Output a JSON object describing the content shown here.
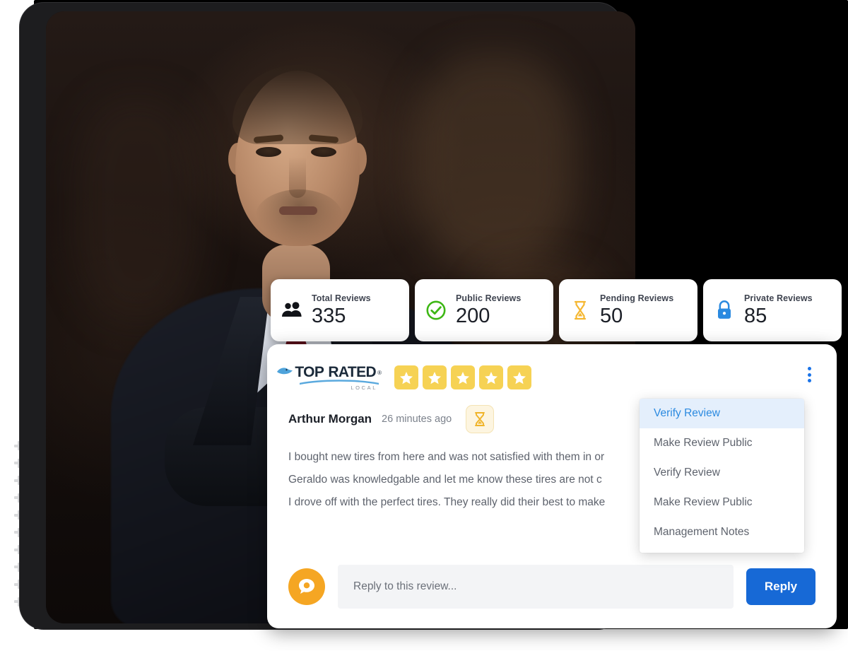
{
  "stats": [
    {
      "icon": "people-icon",
      "label": "Total Reviews",
      "value": "335",
      "color": "#1b1f27"
    },
    {
      "icon": "check-circle-icon",
      "label": "Public Reviews",
      "value": "200",
      "color": "#3db714"
    },
    {
      "icon": "hourglass-icon",
      "label": "Pending Reviews",
      "value": "50",
      "color": "#f5b731"
    },
    {
      "icon": "lock-icon",
      "label": "Private Reviews",
      "value": "85",
      "color": "#2b8ae0"
    }
  ],
  "review": {
    "brand": {
      "word_top": "TOP",
      "word_rated": "RATED",
      "registered": "®",
      "sub": "LOCAL"
    },
    "rating": 5,
    "star_color": "#f6d254",
    "reviewer_name": "Arthur Morgan",
    "time_ago": "26 minutes ago",
    "status_icon": "hourglass-icon",
    "body": "I bought new tires from here and was not satisfied with them in or\nGeraldo was knowledgable and let me know these tires are  not c\nI drove off with the perfect tires. They really did their best to make",
    "menu_icon": "kebab-menu-icon"
  },
  "reply": {
    "avatar_icon": "chat-bubble-icon",
    "placeholder": "Reply to this review...",
    "value": "",
    "button_label": "Reply",
    "button_color": "#1769d6"
  },
  "dropdown": {
    "items": [
      {
        "label": "Verify Review",
        "active": true
      },
      {
        "label": "Make Review Public",
        "active": false
      },
      {
        "label": "Verify Review",
        "active": false
      },
      {
        "label": "Make Review Public",
        "active": false
      },
      {
        "label": "Management Notes",
        "active": false
      }
    ],
    "active_color": "#2b8ae0"
  }
}
